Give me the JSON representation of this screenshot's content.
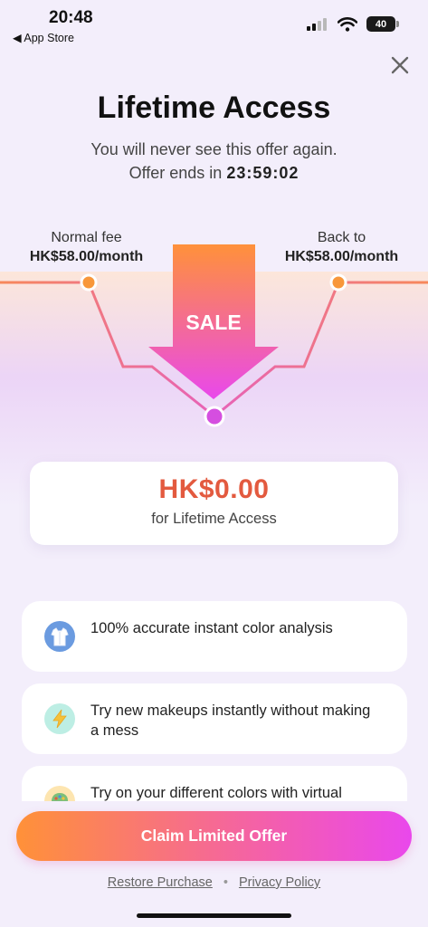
{
  "status_bar": {
    "time": "20:48",
    "back_label": "◀ App Store",
    "battery": "40"
  },
  "header": {
    "close_icon": "close-icon",
    "title": "Lifetime Access",
    "subtitle": "You will never see this offer again.",
    "offer_prefix": "Offer ends in ",
    "countdown": "23:59:02"
  },
  "price_graph": {
    "left_label": "Normal fee",
    "left_price": "HK$58.00/month",
    "right_label": "Back to",
    "right_price": "HK$58.00/month",
    "sale_label": "SALE",
    "colors": {
      "line": "#f7885a",
      "dot_orange": "#f8973a",
      "dot_purple": "#d54ee0",
      "arrow_top": "#ff913a",
      "arrow_bottom": "#e948ec"
    }
  },
  "price_card": {
    "amount": "HK$0.00",
    "description": "for Lifetime Access"
  },
  "features": [
    {
      "icon": "shirt-icon",
      "text": "100% accurate instant color analysis"
    },
    {
      "icon": "lightning-icon",
      "text": "Try new makeups instantly without making a mess"
    },
    {
      "icon": "palette-icon",
      "text": "Try on your different colors with virtual"
    }
  ],
  "cta": {
    "label": "Claim Limited Offer"
  },
  "footer": {
    "restore": "Restore Purchase",
    "separator": "•",
    "privacy": "Privacy Policy"
  }
}
